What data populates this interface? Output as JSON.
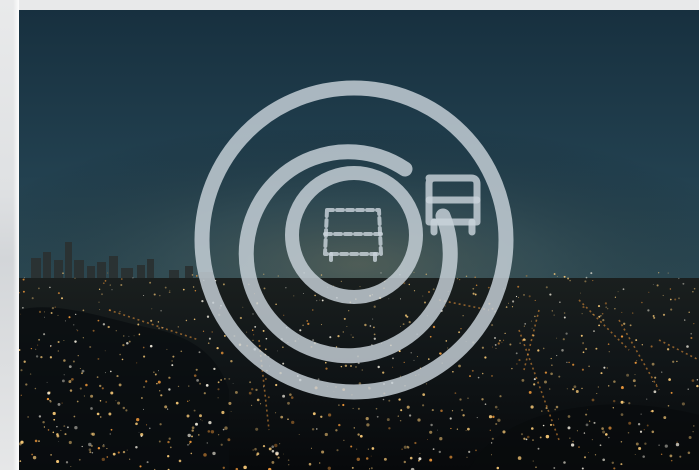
{
  "image": {
    "scene": "night-city-skyline",
    "logo": "bus-stop-target-icon"
  },
  "colors": {
    "sky_top": "#1a3445",
    "sky_mid": "#274a5b",
    "horizon": "#4f5a52",
    "city_dark": "#0c1114",
    "light_warm": "#ffcf7a",
    "light_orange": "#f29a3a",
    "logo_stroke": "#c9d3da"
  }
}
